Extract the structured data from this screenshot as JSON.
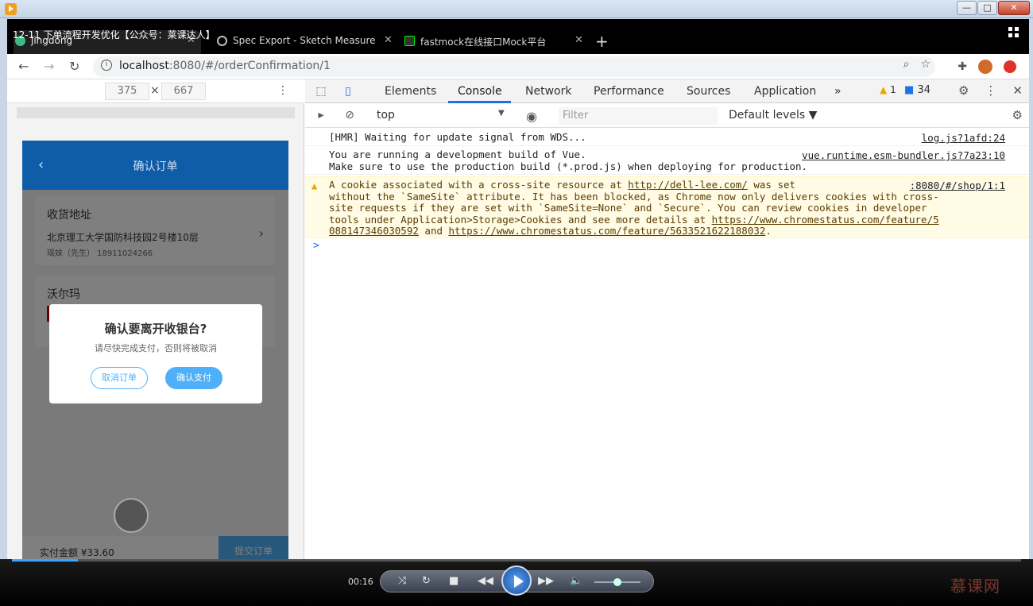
{
  "player": {
    "window_buttons": [
      "—",
      "□",
      "✕"
    ],
    "overlay_title": "12-11 下单流程开发优化【公众号：莱课达人】",
    "time": "00:16",
    "progress": 0.065,
    "volume": 0.5,
    "brand": "慕课网"
  },
  "browser": {
    "tabs": [
      {
        "label": "jingdong",
        "active": true
      },
      {
        "label": "Spec Export - Sketch Measure",
        "active": false
      },
      {
        "label": "fastmock在线接口Mock平台",
        "active": false
      }
    ],
    "url_host": "localhost",
    "url_path": ":8080/#/orderConfirmation/1"
  },
  "device": {
    "width": "375",
    "height": "667",
    "times": "×"
  },
  "app": {
    "title": "确认订单",
    "address_title": "收货地址",
    "address_line": "北京理工大学国防科技园2号楼10层",
    "contact": "瑶妹（先生）  18911024266",
    "store_name": "沃尔玛",
    "total": "实付金额 ¥33.60",
    "submit": "提交订单",
    "dialog_title": "确认要离开收银台?",
    "dialog_sub": "请尽快完成支付，否则将被取消",
    "dialog_cancel": "取消订单",
    "dialog_confirm": "确认支付"
  },
  "devtools": {
    "tabs": [
      "Elements",
      "Console",
      "Network",
      "Performance",
      "Sources",
      "Application"
    ],
    "active_tab": "Console",
    "more": "»",
    "warn_count": "1",
    "msg_count": "34",
    "context": "top",
    "filter_placeholder": "Filter",
    "levels": "Default levels ▼",
    "messages": {
      "hmr": "[HMR] Waiting for update signal from WDS...",
      "hmr_src": "log.js?1afd:24",
      "vue1": "You are running a development build of Vue.",
      "vue2": "Make sure to use the production build (*.prod.js) when deploying for production.",
      "vue_src": "vue.runtime.esm-bundler.js?7a23:10",
      "cookie_l1_a": "A cookie associated with a cross-site resource at ",
      "cookie_l1_link": "http://dell-lee.com/",
      "cookie_l1_b": " was set",
      "cookie_src": ":8080/#/shop/1:1",
      "cookie_l2": "without the `SameSite` attribute. It has been blocked, as Chrome now only delivers cookies with cross-",
      "cookie_l3": "site requests if they are set with `SameSite=None` and `Secure`. You can review cookies in developer",
      "cookie_l4_a": "tools under Application>Storage>Cookies and see more details at ",
      "cookie_l4_link": "https://www.chromestatus.com/feature/5",
      "cookie_l5_link1": "088147346030592",
      "cookie_l5_and": " and ",
      "cookie_l5_link2": "https://www.chromestatus.com/feature/5633521622188032",
      "cookie_l5_end": ".",
      "prompt": ">"
    }
  }
}
